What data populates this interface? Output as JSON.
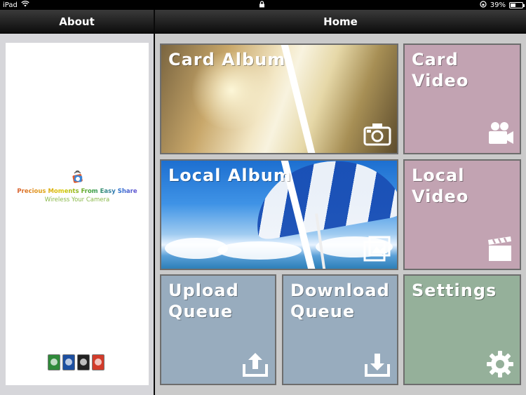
{
  "status_bar": {
    "device": "iPad",
    "battery_text": "39%",
    "battery_level": 0.39
  },
  "sidebar": {
    "title": "About",
    "tagline_1": "Precious Moments From Easy Share",
    "tagline_2": "Wireless Your Camera",
    "card_colors": [
      "#2f8a3a",
      "#1d4fa0",
      "#222222",
      "#d23b2a"
    ]
  },
  "header": {
    "title": "Home"
  },
  "tiles": {
    "card_album": {
      "label": "Card Album",
      "icon": "camera-icon"
    },
    "card_video": {
      "label": "Card\nVideo",
      "icon": "video-camera-icon"
    },
    "local_album": {
      "label": "Local Album",
      "icon": "photos-icon"
    },
    "local_video": {
      "label": "Local\nVideo",
      "icon": "clapperboard-icon"
    },
    "upload_queue": {
      "label": "Upload\nQueue",
      "icon": "upload-icon"
    },
    "download_queue": {
      "label": "Download\nQueue",
      "icon": "download-icon"
    },
    "settings": {
      "label": "Settings",
      "icon": "gear-icon"
    }
  },
  "colors": {
    "video_tile": "#c2a3b2",
    "queue_tile": "#98acbe",
    "settings_tile": "#95b09a"
  }
}
